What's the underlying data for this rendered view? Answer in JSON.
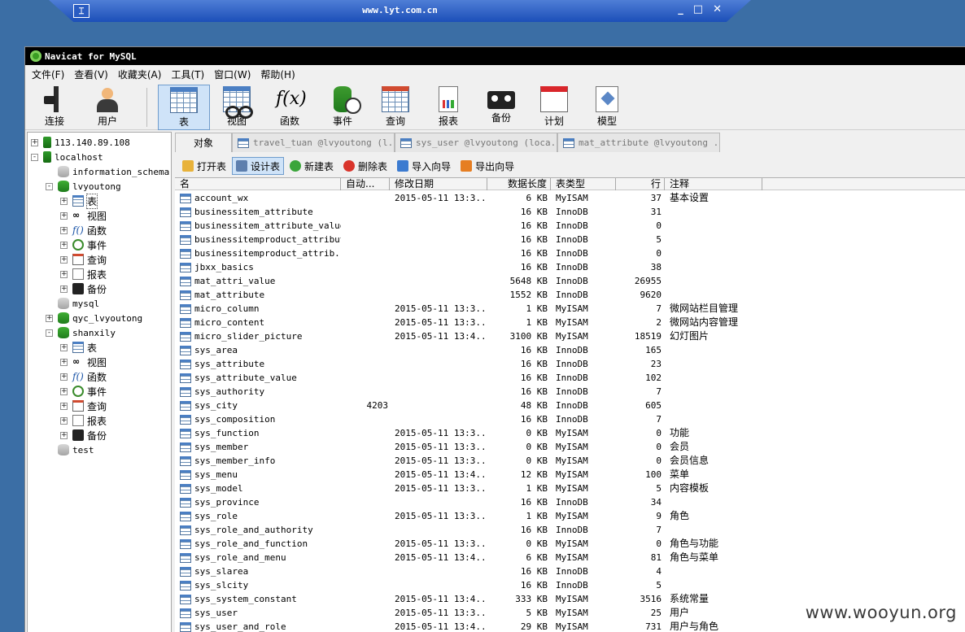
{
  "remote_bar": {
    "host": "www.lyt.com.cn",
    "pin_glyph": "⌶",
    "minimize": "_",
    "restore": "□",
    "close": "✕"
  },
  "window": {
    "title": "Navicat for MySQL"
  },
  "menu": [
    "文件(F)",
    "查看(V)",
    "收藏夹(A)",
    "工具(T)",
    "窗口(W)",
    "帮助(H)"
  ],
  "toolbar": [
    {
      "label": "连接",
      "icon": "plug-icon"
    },
    {
      "label": "用户",
      "icon": "user-icon"
    },
    {
      "label": "表",
      "icon": "table-icon",
      "active": true
    },
    {
      "label": "视图",
      "icon": "view-glasses-icon"
    },
    {
      "label": "函数",
      "icon": "function-icon"
    },
    {
      "label": "事件",
      "icon": "event-clock-icon"
    },
    {
      "label": "查询",
      "icon": "query-icon"
    },
    {
      "label": "报表",
      "icon": "report-icon"
    },
    {
      "label": "备份",
      "icon": "backup-tape-icon"
    },
    {
      "label": "计划",
      "icon": "schedule-calendar-icon"
    },
    {
      "label": "模型",
      "icon": "model-icon"
    }
  ],
  "tree": [
    {
      "label": "113.140.89.108",
      "type": "server",
      "exp": "+"
    },
    {
      "label": "localhost",
      "type": "server",
      "exp": "-"
    },
    {
      "label": "information_schema",
      "type": "db-grey"
    },
    {
      "label": "lvyoutong",
      "type": "db-green",
      "exp": "-"
    },
    {
      "label": "表",
      "type": "table",
      "exp": "+",
      "selected": true
    },
    {
      "label": "视图",
      "type": "view",
      "exp": "+"
    },
    {
      "label": "函数",
      "type": "function",
      "exp": "+"
    },
    {
      "label": "事件",
      "type": "event",
      "exp": "+"
    },
    {
      "label": "查询",
      "type": "query",
      "exp": "+"
    },
    {
      "label": "报表",
      "type": "report",
      "exp": "+"
    },
    {
      "label": "备份",
      "type": "backup",
      "exp": "+"
    },
    {
      "label": "mysql",
      "type": "db-grey"
    },
    {
      "label": "qyc_lvyoutong",
      "type": "db-green",
      "exp": "+"
    },
    {
      "label": "shanxily",
      "type": "db-green",
      "exp": "-"
    },
    {
      "label": "表",
      "type": "table",
      "exp": "+"
    },
    {
      "label": "视图",
      "type": "view",
      "exp": "+"
    },
    {
      "label": "函数",
      "type": "function",
      "exp": "+"
    },
    {
      "label": "事件",
      "type": "event",
      "exp": "+"
    },
    {
      "label": "查询",
      "type": "query",
      "exp": "+"
    },
    {
      "label": "报表",
      "type": "report",
      "exp": "+"
    },
    {
      "label": "备份",
      "type": "backup",
      "exp": "+"
    },
    {
      "label": "test",
      "type": "db-grey"
    }
  ],
  "tabs": [
    {
      "label": "对象",
      "kind": "object"
    },
    {
      "label": "travel_tuan @lvyoutong (l...",
      "kind": "table"
    },
    {
      "label": "sys_user @lvyoutong (loca...",
      "kind": "table"
    },
    {
      "label": "mat_attribute @lvyoutong ...",
      "kind": "table"
    }
  ],
  "object_toolbar": [
    {
      "label": "打开表",
      "color": "#e8b23a"
    },
    {
      "label": "设计表",
      "color": "#5d7fae",
      "active": true
    },
    {
      "label": "新建表",
      "color": "#3aa53a"
    },
    {
      "label": "删除表",
      "color": "#d9342b"
    },
    {
      "label": "导入向导",
      "color": "#3c7bd0"
    },
    {
      "label": "导出向导",
      "color": "#e67e22"
    }
  ],
  "columns": [
    "名",
    "自动...",
    "修改日期",
    "数据长度",
    "表类型",
    "行",
    "注释"
  ],
  "rows": [
    {
      "name": "account_wx",
      "auto": "",
      "mod": "2015-05-11 13:3...",
      "size": "6 KB",
      "engine": "MyISAM",
      "rows": "37",
      "comment": "基本设置"
    },
    {
      "name": "businessitem_attribute",
      "auto": "",
      "mod": "",
      "size": "16 KB",
      "engine": "InnoDB",
      "rows": "31",
      "comment": ""
    },
    {
      "name": "businessitem_attribute_value",
      "auto": "",
      "mod": "",
      "size": "16 KB",
      "engine": "InnoDB",
      "rows": "0",
      "comment": ""
    },
    {
      "name": "businessitemproduct_attribute",
      "auto": "",
      "mod": "",
      "size": "16 KB",
      "engine": "InnoDB",
      "rows": "5",
      "comment": ""
    },
    {
      "name": "businessitemproduct_attrib...",
      "auto": "",
      "mod": "",
      "size": "16 KB",
      "engine": "InnoDB",
      "rows": "0",
      "comment": ""
    },
    {
      "name": "jbxx_basics",
      "auto": "",
      "mod": "",
      "size": "16 KB",
      "engine": "InnoDB",
      "rows": "38",
      "comment": ""
    },
    {
      "name": "mat_attri_value",
      "auto": "",
      "mod": "",
      "size": "5648 KB",
      "engine": "InnoDB",
      "rows": "26955",
      "comment": ""
    },
    {
      "name": "mat_attribute",
      "auto": "",
      "mod": "",
      "size": "1552 KB",
      "engine": "InnoDB",
      "rows": "9620",
      "comment": ""
    },
    {
      "name": "micro_column",
      "auto": "",
      "mod": "2015-05-11 13:3...",
      "size": "1 KB",
      "engine": "MyISAM",
      "rows": "7",
      "comment": "微网站栏目管理"
    },
    {
      "name": "micro_content",
      "auto": "",
      "mod": "2015-05-11 13:3...",
      "size": "1 KB",
      "engine": "MyISAM",
      "rows": "2",
      "comment": "微网站内容管理"
    },
    {
      "name": "micro_slider_picture",
      "auto": "",
      "mod": "2015-05-11 13:4...",
      "size": "3100 KB",
      "engine": "MyISAM",
      "rows": "18519",
      "comment": "幻灯图片"
    },
    {
      "name": "sys_area",
      "auto": "",
      "mod": "",
      "size": "16 KB",
      "engine": "InnoDB",
      "rows": "165",
      "comment": ""
    },
    {
      "name": "sys_attribute",
      "auto": "",
      "mod": "",
      "size": "16 KB",
      "engine": "InnoDB",
      "rows": "23",
      "comment": ""
    },
    {
      "name": "sys_attribute_value",
      "auto": "",
      "mod": "",
      "size": "16 KB",
      "engine": "InnoDB",
      "rows": "102",
      "comment": ""
    },
    {
      "name": "sys_authority",
      "auto": "",
      "mod": "",
      "size": "16 KB",
      "engine": "InnoDB",
      "rows": "7",
      "comment": ""
    },
    {
      "name": "sys_city",
      "auto": "4203",
      "mod": "",
      "size": "48 KB",
      "engine": "InnoDB",
      "rows": "605",
      "comment": ""
    },
    {
      "name": "sys_composition",
      "auto": "",
      "mod": "",
      "size": "16 KB",
      "engine": "InnoDB",
      "rows": "7",
      "comment": ""
    },
    {
      "name": "sys_function",
      "auto": "",
      "mod": "2015-05-11 13:3...",
      "size": "0 KB",
      "engine": "MyISAM",
      "rows": "0",
      "comment": "功能"
    },
    {
      "name": "sys_member",
      "auto": "",
      "mod": "2015-05-11 13:3...",
      "size": "0 KB",
      "engine": "MyISAM",
      "rows": "0",
      "comment": "会员"
    },
    {
      "name": "sys_member_info",
      "auto": "",
      "mod": "2015-05-11 13:3...",
      "size": "0 KB",
      "engine": "MyISAM",
      "rows": "0",
      "comment": "会员信息"
    },
    {
      "name": "sys_menu",
      "auto": "",
      "mod": "2015-05-11 13:4...",
      "size": "12 KB",
      "engine": "MyISAM",
      "rows": "100",
      "comment": "菜单"
    },
    {
      "name": "sys_model",
      "auto": "",
      "mod": "2015-05-11 13:3...",
      "size": "1 KB",
      "engine": "MyISAM",
      "rows": "5",
      "comment": "内容模板"
    },
    {
      "name": "sys_province",
      "auto": "",
      "mod": "",
      "size": "16 KB",
      "engine": "InnoDB",
      "rows": "34",
      "comment": ""
    },
    {
      "name": "sys_role",
      "auto": "",
      "mod": "2015-05-11 13:3...",
      "size": "1 KB",
      "engine": "MyISAM",
      "rows": "9",
      "comment": "角色"
    },
    {
      "name": "sys_role_and_authority",
      "auto": "",
      "mod": "",
      "size": "16 KB",
      "engine": "InnoDB",
      "rows": "7",
      "comment": ""
    },
    {
      "name": "sys_role_and_function",
      "auto": "",
      "mod": "2015-05-11 13:3...",
      "size": "0 KB",
      "engine": "MyISAM",
      "rows": "0",
      "comment": "角色与功能"
    },
    {
      "name": "sys_role_and_menu",
      "auto": "",
      "mod": "2015-05-11 13:4...",
      "size": "6 KB",
      "engine": "MyISAM",
      "rows": "81",
      "comment": "角色与菜单"
    },
    {
      "name": "sys_slarea",
      "auto": "",
      "mod": "",
      "size": "16 KB",
      "engine": "InnoDB",
      "rows": "4",
      "comment": ""
    },
    {
      "name": "sys_slcity",
      "auto": "",
      "mod": "",
      "size": "16 KB",
      "engine": "InnoDB",
      "rows": "5",
      "comment": ""
    },
    {
      "name": "sys_system_constant",
      "auto": "",
      "mod": "2015-05-11 13:4...",
      "size": "333 KB",
      "engine": "MyISAM",
      "rows": "3516",
      "comment": "系统常量"
    },
    {
      "name": "sys_user",
      "auto": "",
      "mod": "2015-05-11 13:3...",
      "size": "5 KB",
      "engine": "MyISAM",
      "rows": "25",
      "comment": "用户"
    },
    {
      "name": "sys_user_and_role",
      "auto": "",
      "mod": "2015-05-11 13:4...",
      "size": "29 KB",
      "engine": "MyISAM",
      "rows": "731",
      "comment": "用户与角色"
    }
  ],
  "watermark": "www.wooyun.org"
}
